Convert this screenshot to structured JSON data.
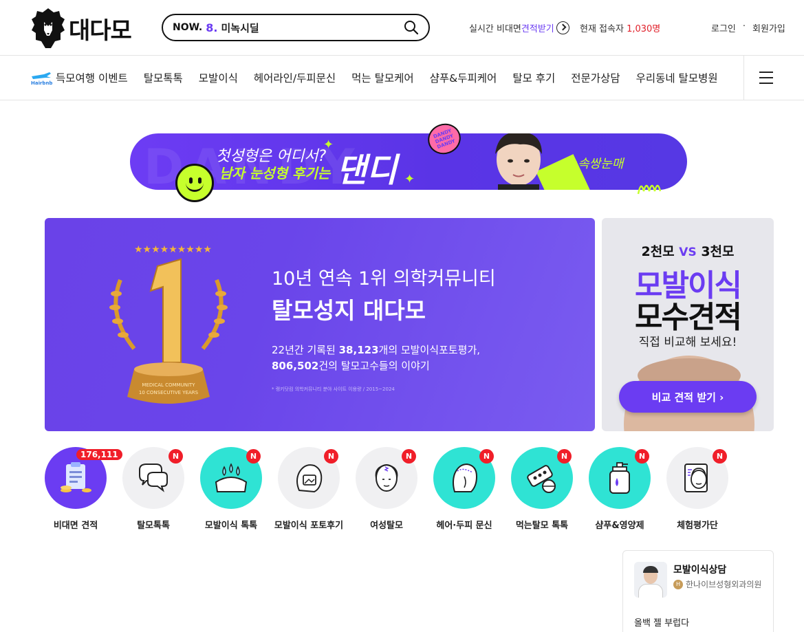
{
  "header": {
    "logo_text": "대다모",
    "search": {
      "now_label": "NOW.",
      "rank": "8.",
      "keyword": "미녹시딜"
    },
    "realtime": {
      "prefix": "실시간 비대면",
      "accent": "견적받기"
    },
    "visitors": {
      "label": "현재 접속자",
      "count": "1,030명"
    },
    "auth": {
      "login": "로그인",
      "separator": "·",
      "signup": "회원가입"
    }
  },
  "nav": {
    "items": [
      {
        "label": "득모여행 이벤트",
        "icon": "hairbnb-plane-icon"
      },
      {
        "label": "탈모톡톡"
      },
      {
        "label": "모발이식"
      },
      {
        "label": "헤어라인/두피문신"
      },
      {
        "label": "먹는 탈모케어"
      },
      {
        "label": "샴푸&두피케어"
      },
      {
        "label": "탈모 후기"
      },
      {
        "label": "전문가상담"
      },
      {
        "label": "우리동네 탈모병원"
      }
    ],
    "hairbnb_label": "Hairbnb",
    "menu_icon": "hamburger-menu-icon"
  },
  "ad_banner": {
    "line1": "첫성형은 어디서?",
    "line2": "남자 눈성형 후기는",
    "brand": "댄디",
    "tag": "#속쌍눈매",
    "badge": "DANDY DANDY DANDY",
    "bg_word": "DANDY"
  },
  "hero": {
    "line1": "10년 연속 1위 의학커뮤니티",
    "line2": "탈모성지 대다모",
    "line3_prefix": "22년간 기록된 ",
    "line3_bold": "38,123",
    "line3_suffix": "개의 모발이식포토평가,",
    "line4_bold": "806,502",
    "line4_suffix": "건의 탈모고수들의 이야기",
    "note": "* 랭키닷컴 의학커뮤니티 분야 사이트 이용량 / 2015~2024",
    "trophy_number": "1",
    "trophy_caption_1": "MEDICAL COMMUNITY",
    "trophy_caption_2": "10 CONSECUTIVE YEARS"
  },
  "side_ad": {
    "vs_left": "2천모",
    "vs_mid": "VS",
    "vs_right": "3천모",
    "big1": "모발이식",
    "big2": "모수견적",
    "sub": "직접 비교해 보세요!",
    "cta": "비교 견적 받기 ›"
  },
  "categories": [
    {
      "label": "비대면 견적",
      "badge": "176,111",
      "icon": "clipboard-coins-icon",
      "bg": "#6b3cf2"
    },
    {
      "label": "탈모톡톡",
      "badge": "N",
      "icon": "chat-bubbles-icon",
      "bg": "#f0f0f2"
    },
    {
      "label": "모발이식 톡톡",
      "badge": "N",
      "icon": "transplant-drops-icon",
      "bg": "#2fe3d4"
    },
    {
      "label": "모발이식 포토후기",
      "badge": "N",
      "icon": "photo-head-icon",
      "bg": "#f0f0f2"
    },
    {
      "label": "여성탈모",
      "badge": "N",
      "icon": "woman-head-icon",
      "bg": "#f0f0f2"
    },
    {
      "label": "헤어·두피 문신",
      "badge": "N",
      "icon": "scalp-tattoo-icon",
      "bg": "#2fe3d4"
    },
    {
      "label": "먹는탈모 톡톡",
      "badge": "N",
      "icon": "pills-icon",
      "bg": "#2fe3d4"
    },
    {
      "label": "샴푸&영양제",
      "badge": "N",
      "icon": "shampoo-bottle-icon",
      "bg": "#2fe3d4"
    },
    {
      "label": "체험평가단",
      "badge": "N",
      "icon": "review-face-icon",
      "bg": "#f0f0f2"
    }
  ],
  "consult": {
    "title": "모발이식상담",
    "hospital_badge": "H",
    "hospital": "한나이브성형외과의원",
    "question": "올백 젤 부럽다"
  }
}
